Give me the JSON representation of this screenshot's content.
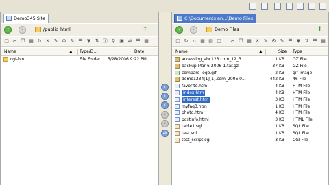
{
  "left": {
    "tab_title": "Demo345 Site",
    "path": "/public_html",
    "columns": {
      "name": "Name",
      "type": "Type/D...",
      "date": "Date"
    },
    "files": [
      {
        "name": "cgi-bin",
        "type": "File Folder",
        "date": "5/28/2006 9:22 PM",
        "icon": "folder-icon"
      }
    ]
  },
  "right": {
    "tab_title": "C:\\Documents an...\\Demo Files",
    "path": "Demo Files",
    "columns": {
      "name": "Name",
      "size": "Size",
      "type": "Type"
    },
    "files": [
      {
        "name": "accesslog_abc123.com_12_3...",
        "size": "1 KB",
        "type": "GZ File",
        "icon": "gz",
        "selected": false
      },
      {
        "name": "backup-Mar-6-2006-1.tar.gz",
        "size": "37 KB",
        "type": "GZ File",
        "icon": "gz",
        "selected": false
      },
      {
        "name": "compare-logo.gif",
        "size": "2 KB",
        "type": "gif Image",
        "icon": "img",
        "selected": false
      },
      {
        "name": "demo1234[1][1].com_2006.0...",
        "size": "442 KB",
        "type": "46 File",
        "icon": "gz",
        "selected": false
      },
      {
        "name": "favorite.htm",
        "size": "4 KB",
        "type": "HTM File",
        "icon": "htm",
        "selected": false
      },
      {
        "name": "index.htm",
        "size": "4 KB",
        "type": "HTM File",
        "icon": "htm",
        "selected": true
      },
      {
        "name": "interest.htm",
        "size": "3 KB",
        "type": "HTM File",
        "icon": "htm",
        "selected": true
      },
      {
        "name": "myfaq3.htm",
        "size": "1 KB",
        "type": "HTM File",
        "icon": "htm",
        "selected": false
      },
      {
        "name": "photo.htm",
        "size": "4 KB",
        "type": "HTM File",
        "icon": "htm",
        "selected": false
      },
      {
        "name": "postinfo.html",
        "size": "3 KB",
        "type": "HTML File",
        "icon": "htm",
        "selected": false
      },
      {
        "name": "table1.sql",
        "size": "1 KB",
        "type": "SQL File",
        "icon": "sql",
        "selected": false
      },
      {
        "name": "test.sql",
        "size": "1 KB",
        "type": "SQL File",
        "icon": "sql",
        "selected": false
      },
      {
        "name": "test_script.cgi",
        "size": "3 KB",
        "type": "CGI File",
        "icon": "sql",
        "selected": false
      }
    ]
  },
  "colors": {
    "selection": "#316ac5",
    "chrome": "#ece9d8"
  }
}
